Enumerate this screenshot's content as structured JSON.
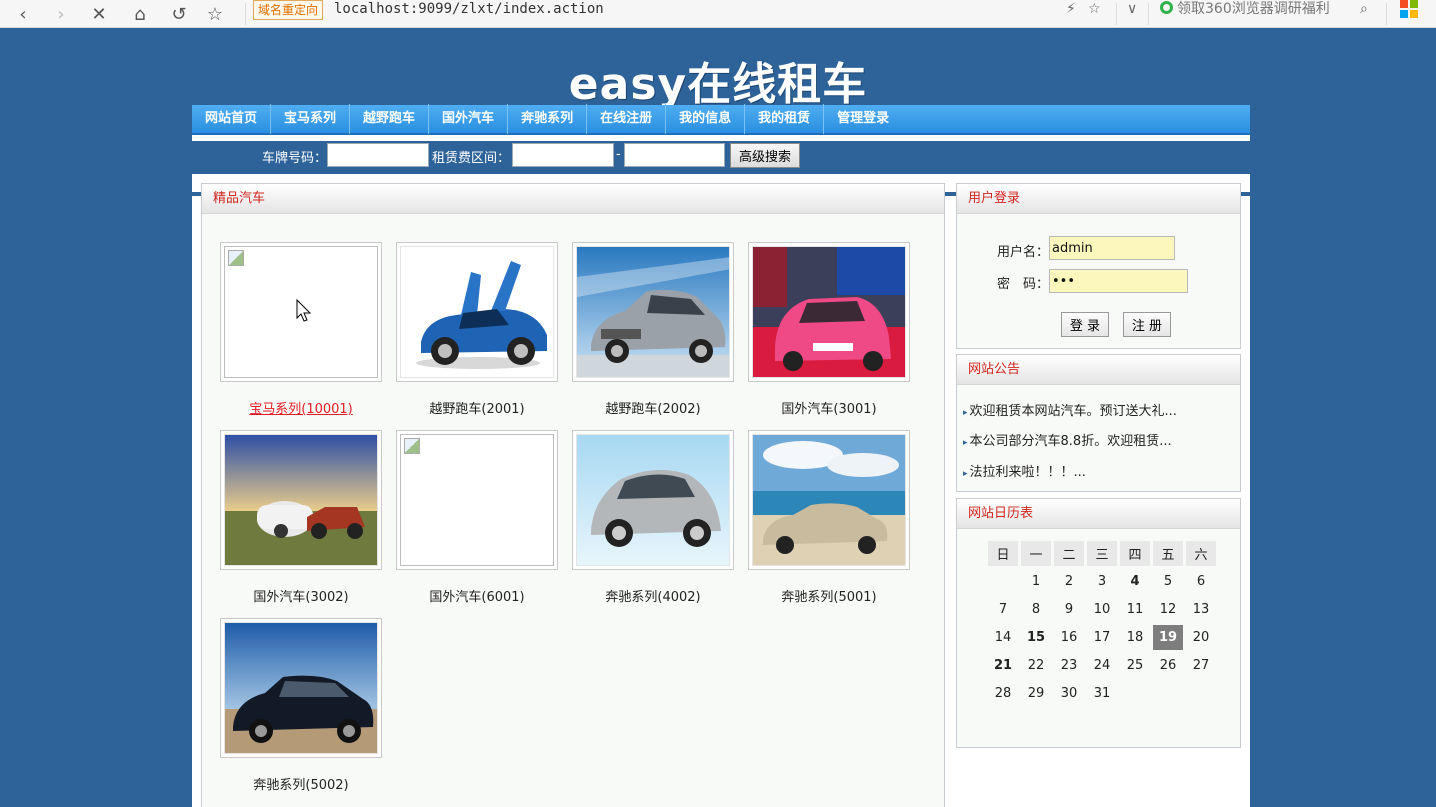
{
  "browser": {
    "redirect_tag": "域名重定向",
    "url": "localhost:9099/zlxt/index.action",
    "promo": "领取360浏览器调研福利"
  },
  "site": {
    "title": "easy在线租车"
  },
  "nav": {
    "items": [
      "网站首页",
      "宝马系列",
      "越野跑车",
      "国外汽车",
      "奔驰系列",
      "在线注册",
      "我的信息",
      "我的租赁",
      "管理登录"
    ]
  },
  "search": {
    "plate_label": "车牌号码：",
    "price_label": "租赁费区间：",
    "dash": "-",
    "button": "高级搜索"
  },
  "products": {
    "title": "精品汽车",
    "cars": [
      {
        "caption": "宝马系列(10001)",
        "active": true,
        "image": "broken"
      },
      {
        "caption": "越野跑车(2001)",
        "image": "blue-gullwing-car"
      },
      {
        "caption": "越野跑车(2002)",
        "image": "silver-sedan"
      },
      {
        "caption": "国外汽车(3001)",
        "image": "pink-car-showroom"
      },
      {
        "caption": "国外汽车(3002)",
        "image": "caravan-field"
      },
      {
        "caption": "国外汽车(6001)",
        "image": "broken"
      },
      {
        "caption": "奔驰系列(4002)",
        "image": "silver-fiat"
      },
      {
        "caption": "奔驰系列(5001)",
        "image": "beach-sedan"
      },
      {
        "caption": "奔驰系列(5002)",
        "image": "black-sedan"
      }
    ]
  },
  "login": {
    "title": "用户登录",
    "username_label": "用户名：",
    "username_value": "admin",
    "password_label": "密　码：",
    "password_value": "•••",
    "login_button": "登 录",
    "register_button": "注 册"
  },
  "notice": {
    "title": "网站公告",
    "items": [
      "欢迎租赁本网站汽车。预订送大礼...",
      "本公司部分汽车8.8折。欢迎租赁...",
      "法拉利来啦！！！..."
    ]
  },
  "calendar": {
    "title": "网站日历表",
    "weekdays": [
      "日",
      "一",
      "二",
      "三",
      "四",
      "五",
      "六"
    ],
    "weeks": [
      [
        "",
        "1",
        "2",
        "3",
        "4",
        "5",
        "6"
      ],
      [
        "7",
        "8",
        "9",
        "10",
        "11",
        "12",
        "13"
      ],
      [
        "14",
        "15",
        "16",
        "17",
        "18",
        "19",
        "20"
      ],
      [
        "21",
        "22",
        "23",
        "24",
        "25",
        "26",
        "27"
      ],
      [
        "28",
        "29",
        "30",
        "31",
        "",
        "",
        ""
      ]
    ],
    "today": "19",
    "bold_days": [
      "4",
      "15",
      "19",
      "21"
    ]
  }
}
